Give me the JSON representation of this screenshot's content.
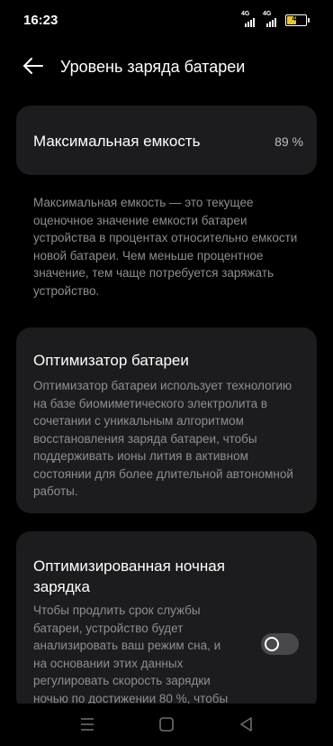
{
  "status": {
    "time": "16:23",
    "signal1_label": "4G",
    "signal2_label": "4G",
    "battery_level": "45",
    "battery_color": "#e7c43a"
  },
  "header": {
    "title": "Уровень заряда батареи",
    "back_icon": "arrow-left-icon"
  },
  "capacity": {
    "label": "Максимальная емкость",
    "value": "89 %"
  },
  "capacity_description": "Максимальная емкость — это текущее оценочное значение емкости батареи устройства в процентах относительно емкости новой батареи. Чем меньше процентное значение, тем чаще потребуется заряжать устройство.",
  "optimizer": {
    "title": "Оптимизатор батареи",
    "description": "Оптимизатор батареи использует технологию на базе биомиметического электролита в сочетании с уникальным алгоритмом восстановления заряда батареи, чтобы поддерживать ионы лития в активном состоянии для более длительной автономной работы."
  },
  "night_charging": {
    "title": "Оптимизированная ночная зарядка",
    "description": "Чтобы продлить срок службы батареи, устройство будет анализировать ваш режим сна, и на основании этих данных регулировать скорость зарядки ночью по достижении 80 %, чтобы",
    "toggle_on": false
  },
  "navbar": {
    "menu_icon": "recent-apps-icon",
    "home_icon": "home-icon",
    "back_icon": "back-triangle-icon"
  }
}
